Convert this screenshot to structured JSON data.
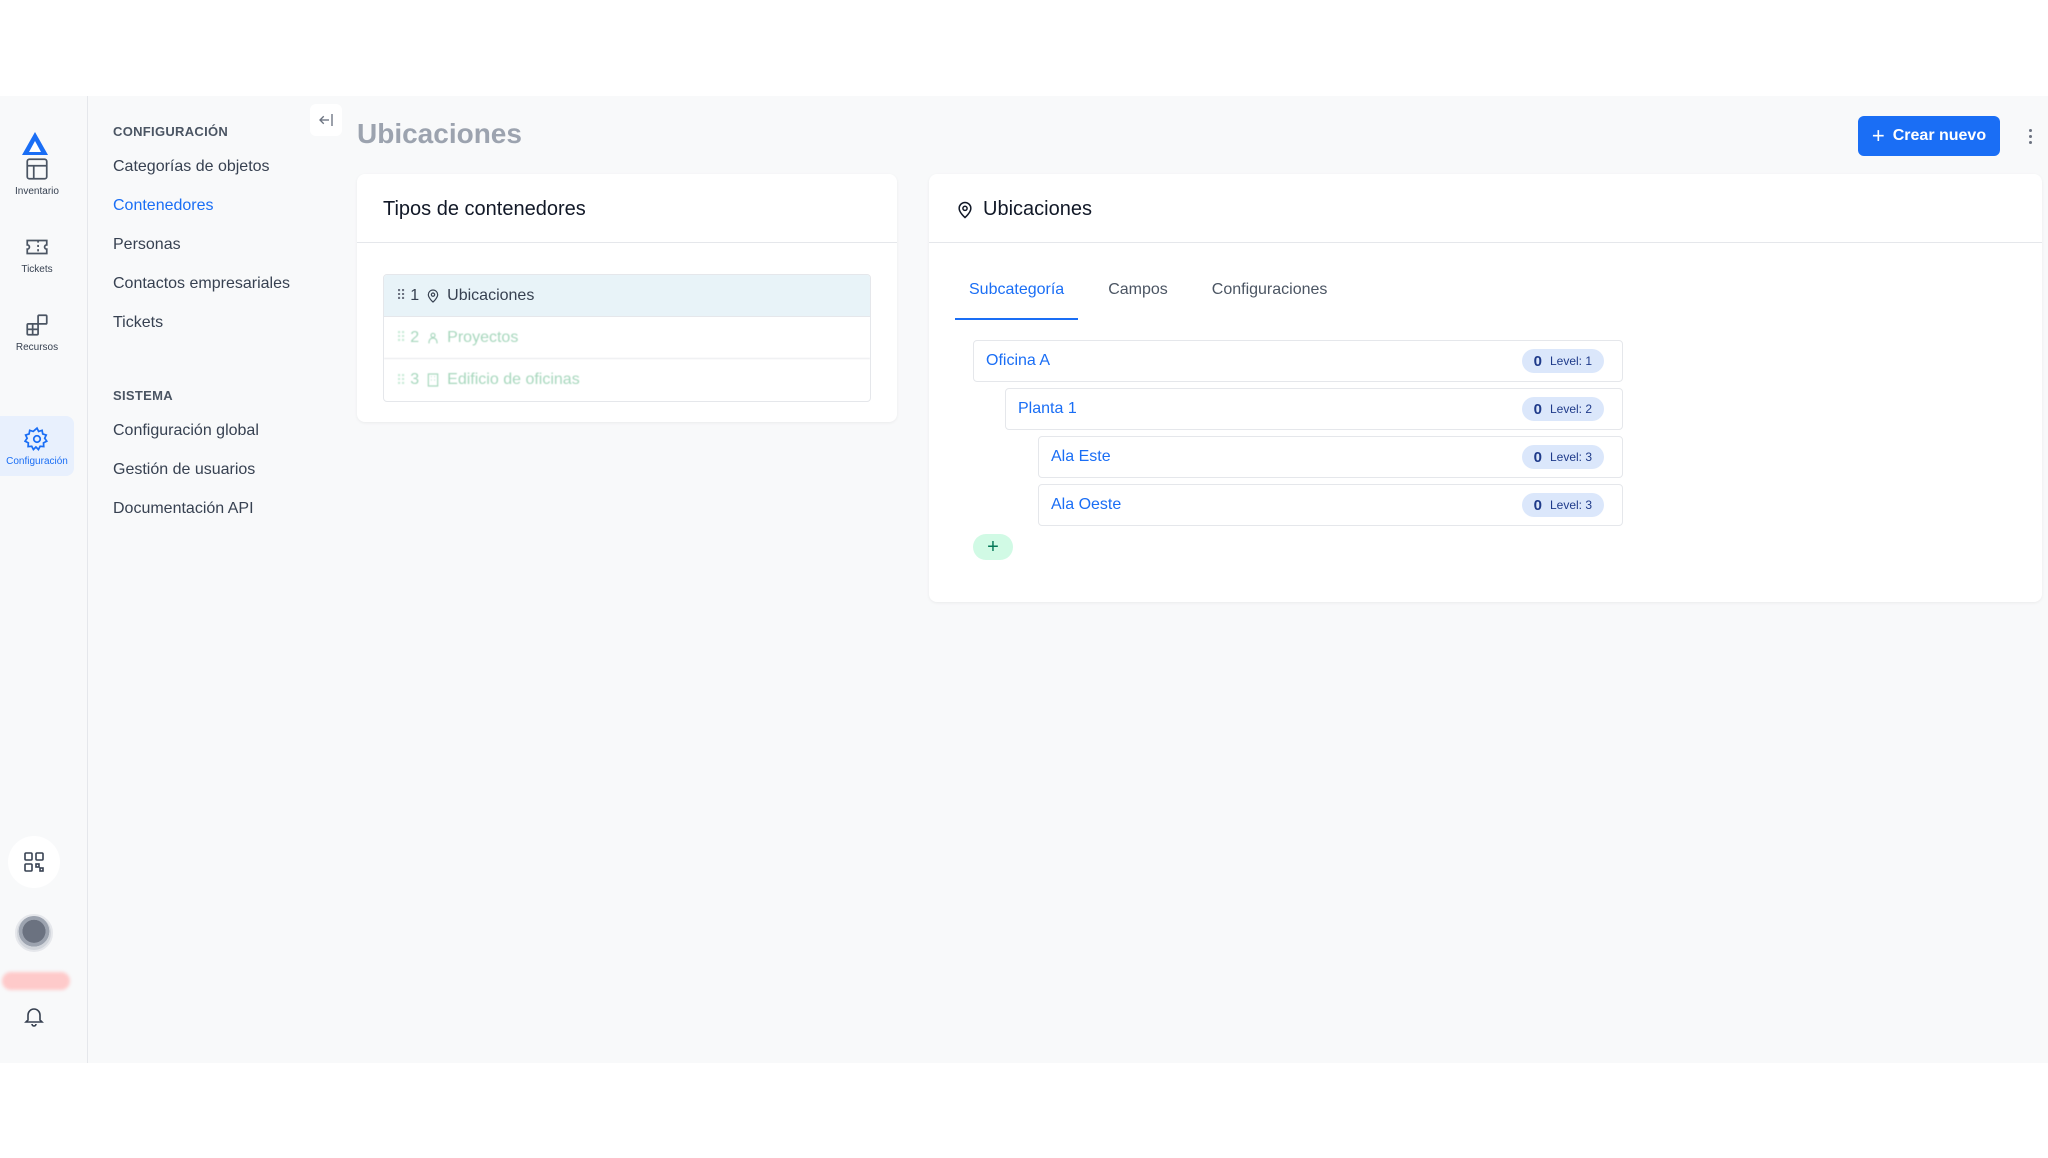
{
  "rail": {
    "items": [
      {
        "label": "Inventario",
        "icon": "table-grid-icon"
      },
      {
        "label": "Tickets",
        "icon": "ticket-icon"
      },
      {
        "label": "Recursos",
        "icon": "blocks-icon"
      },
      {
        "label": "Configuración",
        "icon": "gear-icon"
      }
    ],
    "active_color": "#1a6ef5"
  },
  "subnav": {
    "section_config": "CONFIGURACIÓN",
    "config_items": [
      "Categorías de objetos",
      "Contenedores",
      "Personas",
      "Contactos empresariales",
      "Tickets"
    ],
    "section_system": "SISTEMA",
    "system_items": [
      "Configuración global",
      "Gestión de usuarios",
      "Documentación API"
    ]
  },
  "header": {
    "title": "Ubicaciones",
    "create_label": "Crear nuevo"
  },
  "types_card": {
    "title": "Tipos de contenedores",
    "rows": [
      {
        "num": "1",
        "name": "Ubicaciones",
        "icon": "map-pin-icon"
      },
      {
        "num": "2",
        "name": "Proyectos",
        "icon": "group-icon"
      },
      {
        "num": "3",
        "name": "Edificio de oficinas",
        "icon": "building-icon"
      }
    ]
  },
  "locations_card": {
    "title": "Ubicaciones",
    "tabs": [
      "Subcategoría",
      "Campos",
      "Configuraciones"
    ],
    "tree": [
      {
        "name": "Oficina A",
        "count": "0",
        "level": "Level: 1"
      },
      {
        "name": "Planta 1",
        "count": "0",
        "level": "Level: 2"
      },
      {
        "name": "Ala Este",
        "count": "0",
        "level": "Level: 3"
      },
      {
        "name": "Ala Oeste",
        "count": "0",
        "level": "Level: 3"
      }
    ],
    "add_label": "+"
  }
}
